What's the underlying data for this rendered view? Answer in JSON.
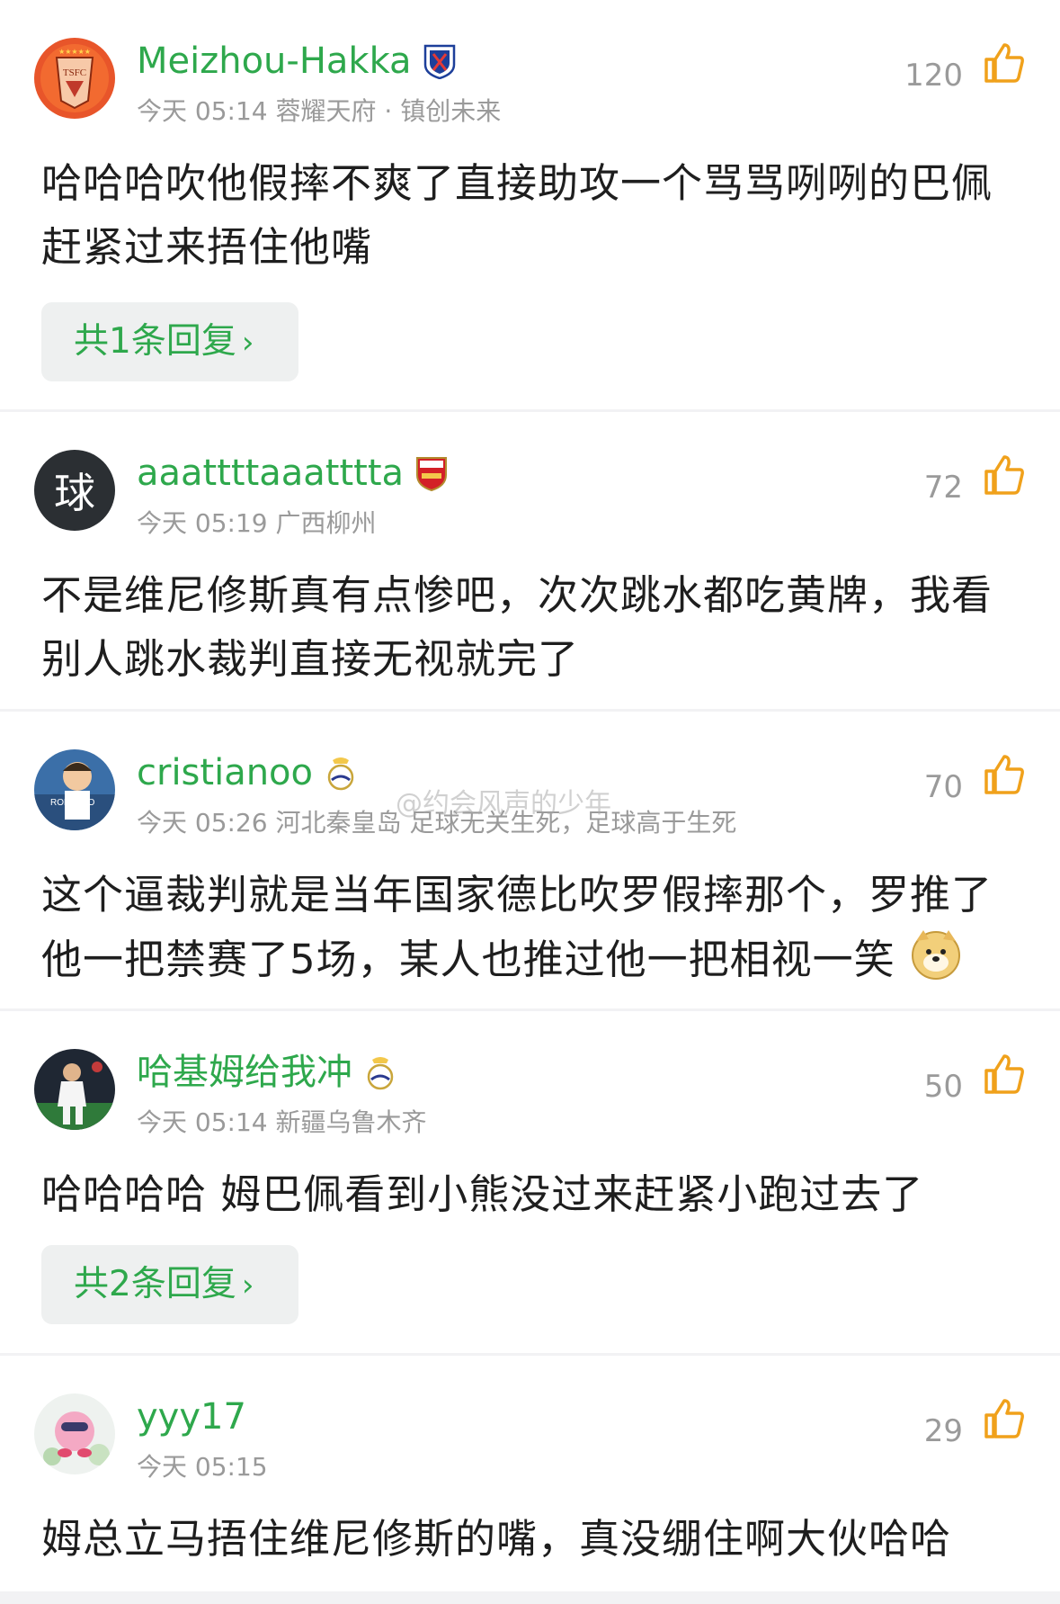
{
  "comments": [
    {
      "username": "Meizhou-Hakka",
      "time": "今天 05:14",
      "location": "蓉耀天府 · 镇创未来",
      "likes": "120",
      "text": "哈哈哈吹他假摔不爽了直接助攻一个骂骂咧咧的巴佩赶紧过来捂住他嘴",
      "reply_label": "共1条回复",
      "avatar_text": "TSFC",
      "badge": "shenhua-club-badge"
    },
    {
      "username": "aaattttaaatttta",
      "time": "今天 05:19",
      "location": "广西柳州",
      "likes": "72",
      "text": "不是维尼修斯真有点惨吧，次次跳水都吃黄牌，我看别人跳水裁判直接无视就完了",
      "avatar_text": "球",
      "badge": "arsenal-club-badge"
    },
    {
      "username": "cristianoo",
      "time": "今天 05:26",
      "location": "河北秦皇岛 足球无关生死，足球高于生死",
      "likes": "70",
      "text": "这个逼裁判就是当年国家德比吹罗假摔那个，罗推了他一把禁赛了5场，某人也推过他一把相视一笑",
      "avatar_text": "RONALDO",
      "badge": "real-madrid-badge",
      "emoji": "doge-emoji"
    },
    {
      "username": "哈基姆给我冲",
      "time": "今天 05:14",
      "location": "新疆乌鲁木齐",
      "likes": "50",
      "text": "哈哈哈哈 姆巴佩看到小熊没过来赶紧小跑过去了",
      "reply_label": "共2条回复",
      "badge": "real-madrid-badge"
    },
    {
      "username": "yyy17",
      "time": "今天 05:15",
      "location": "",
      "likes": "29",
      "text": "姆总立马捂住维尼修斯的嘴，真没绷住啊大伙哈哈"
    }
  ],
  "watermark": "@约会风声的少年",
  "reply_chevron": "›",
  "colors": {
    "username": "#2ea84c",
    "like_icon": "#f0a11b",
    "meta": "#9a9a9a",
    "reply_bg": "#eef0f0"
  },
  "icons": [
    "thumbs-up-icon",
    "chevron-right-icon"
  ]
}
